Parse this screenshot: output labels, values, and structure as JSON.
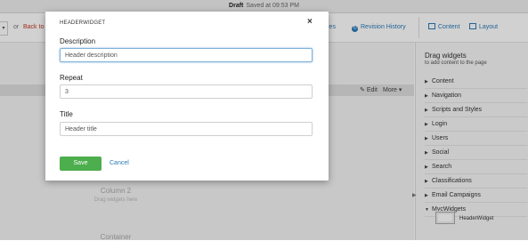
{
  "topbar": {
    "status": "Draft",
    "saved": "Saved at 09:53 PM"
  },
  "toolbar": {
    "caret": "▾",
    "or": "or",
    "back": "Back to",
    "properties_tail": "ies",
    "revision_history": "Revision History",
    "content": "Content",
    "layout": "Layout"
  },
  "editor": {
    "edit": "Edit",
    "more": "More",
    "column2": "Column 2",
    "column2_hint": "Drag widgets here",
    "container": "Container"
  },
  "sidebar": {
    "title": "Drag widgets",
    "subtitle": "to add content to the page",
    "categories": [
      {
        "label": "Content",
        "expanded": false
      },
      {
        "label": "Navigation",
        "expanded": false
      },
      {
        "label": "Scripts and Styles",
        "expanded": false
      },
      {
        "label": "Login",
        "expanded": false
      },
      {
        "label": "Users",
        "expanded": false
      },
      {
        "label": "Social",
        "expanded": false
      },
      {
        "label": "Search",
        "expanded": false
      },
      {
        "label": "Classifications",
        "expanded": false
      },
      {
        "label": "Email Campaigns",
        "expanded": false
      },
      {
        "label": "MvcWidgets",
        "expanded": true
      }
    ],
    "widget": "HeaderWidget"
  },
  "modal": {
    "title": "HEADERWIDGET",
    "close": "×",
    "description_label": "Description",
    "description_value": "Header description",
    "repeat_label": "Repeat",
    "repeat_value": "3",
    "title_label": "Title",
    "title_value": "Header title",
    "save": "Save",
    "cancel": "Cancel"
  },
  "colors": {
    "accent": "#2a7ab8",
    "save_green": "#4cae4c",
    "back_red": "#c0392b"
  }
}
